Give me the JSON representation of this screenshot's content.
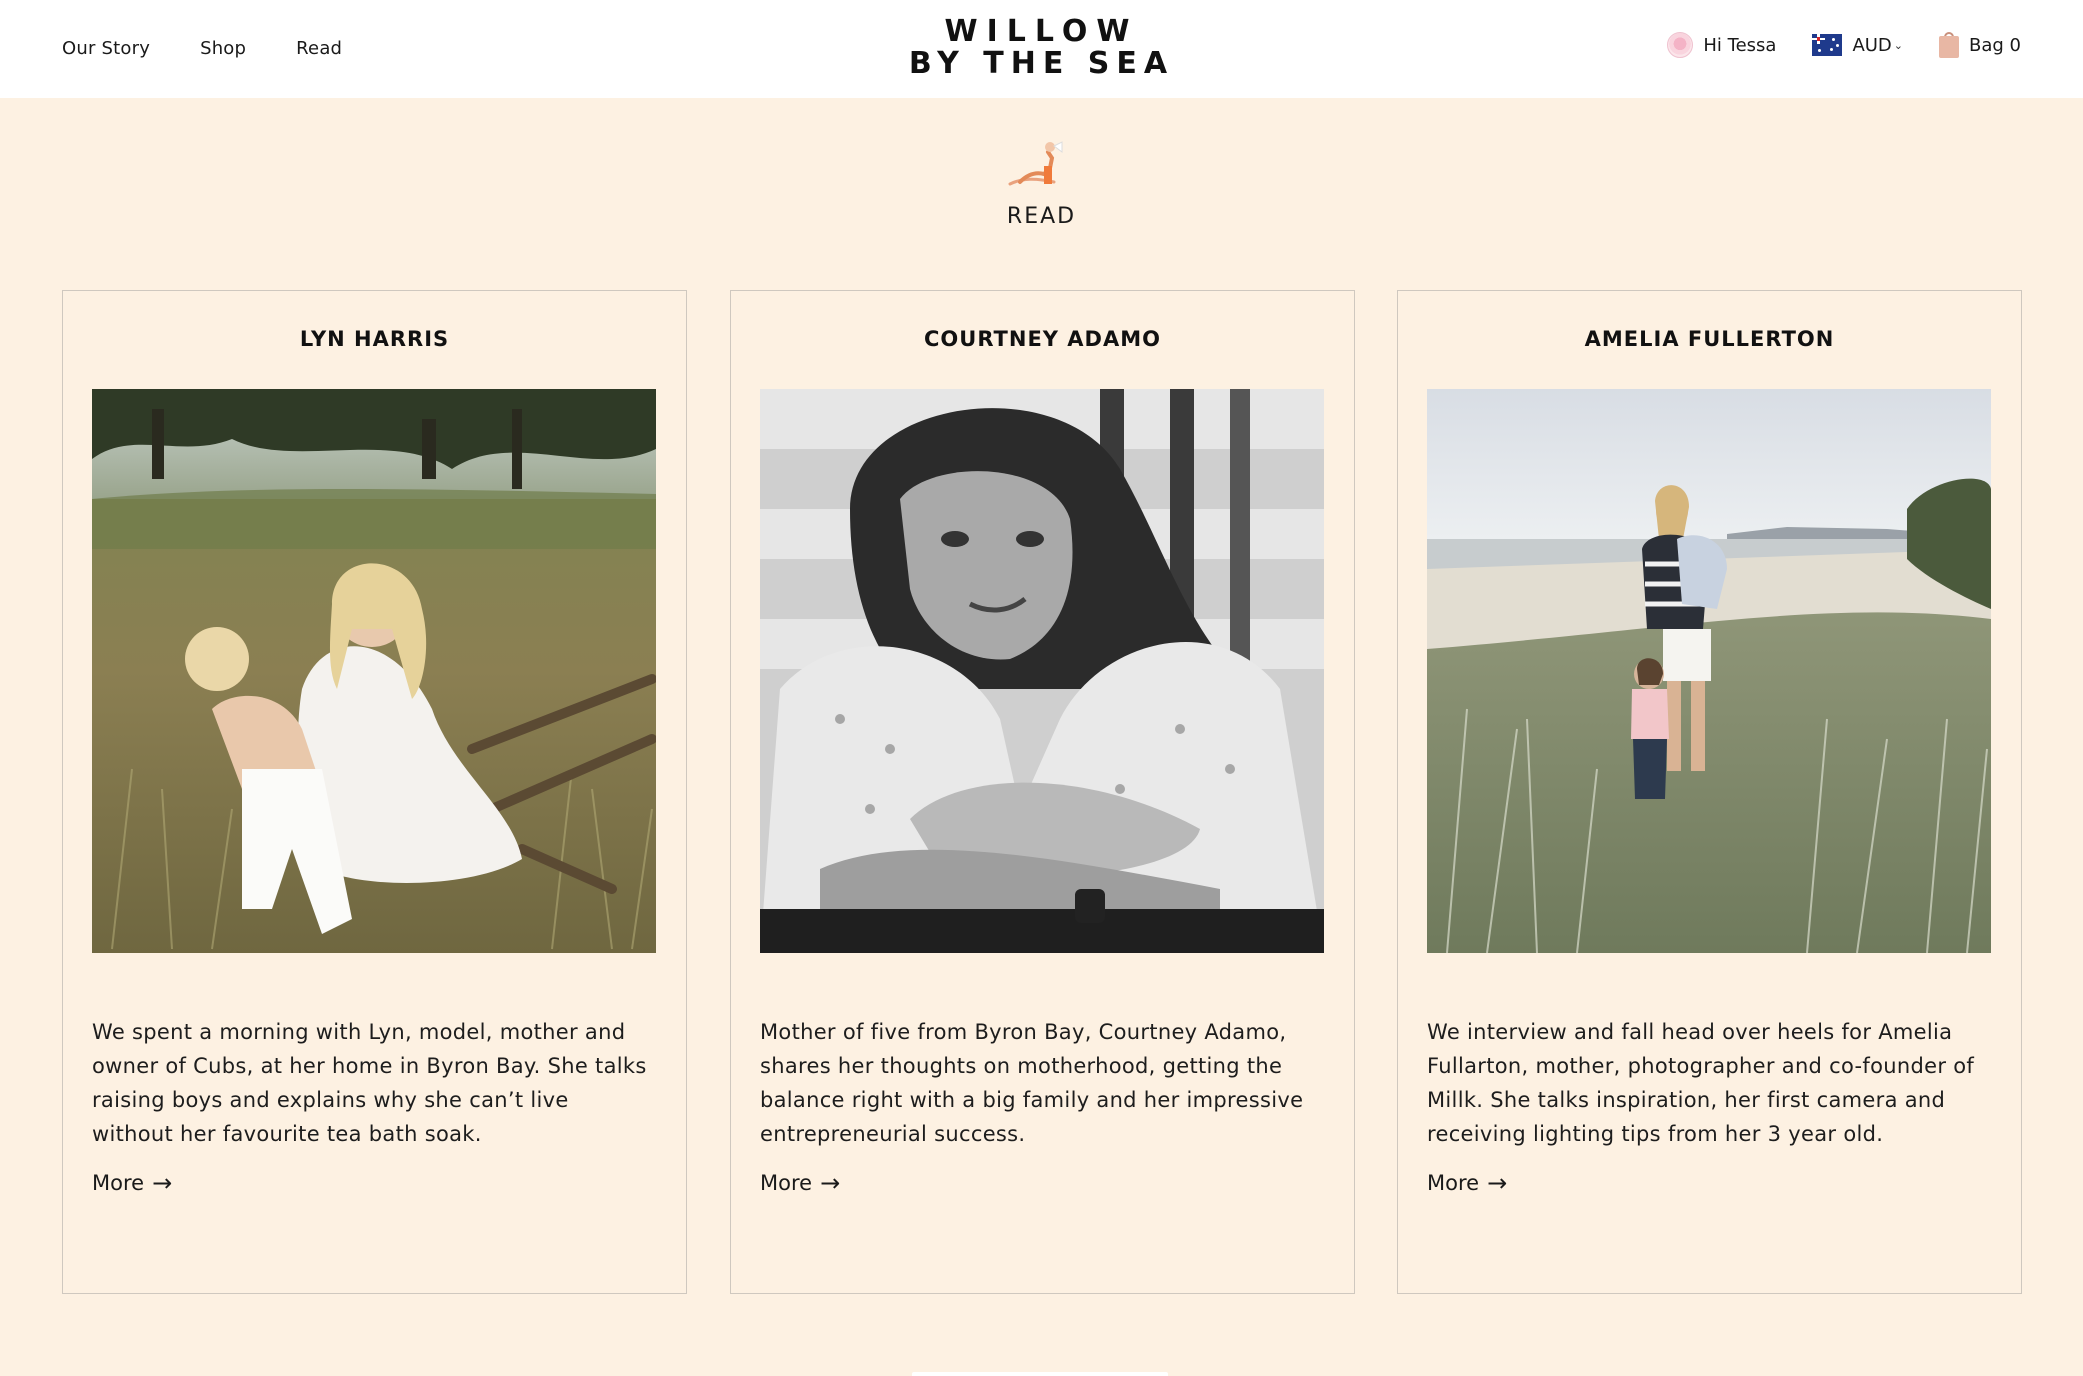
{
  "header": {
    "nav": [
      {
        "label": "Our Story"
      },
      {
        "label": "Shop"
      },
      {
        "label": "Read"
      }
    ],
    "logo_line1": "WILLOW",
    "logo_line2": "BY THE SEA",
    "user_greeting": "Hi Tessa",
    "currency": "AUD",
    "bag_label": "Bag 0"
  },
  "page": {
    "title": "READ"
  },
  "cards": [
    {
      "name": "LYN HARRIS",
      "description": "We spent a morning with Lyn, model, mother and owner of Cubs, at her home in Byron Bay. She talks raising boys and explains why she can’t live without her favourite tea bath soak.",
      "more_label": "More",
      "photo": "mother-child-grass-photo"
    },
    {
      "name": "COURTNEY ADAMO",
      "description": "Mother of five from Byron Bay, Courtney Adamo, shares her thoughts on motherhood, getting the balance right with a big family and her impressive entrepreneurial success.",
      "more_label": "More",
      "photo": "bw-portrait-baby-photo"
    },
    {
      "name": "AMELIA FULLERTON",
      "description": "We interview and fall head over heels for Amelia Fullarton, mother, photographer and co-founder of Millk. She talks inspiration, her first camera and receiving lighting tips from her 3 year old.",
      "more_label": "More",
      "photo": "beach-dunes-family-photo"
    }
  ],
  "colors": {
    "background": "#fdf1e2",
    "header": "#ffffff",
    "card_border": "#cfc8bf",
    "text": "#1a1a1a"
  }
}
